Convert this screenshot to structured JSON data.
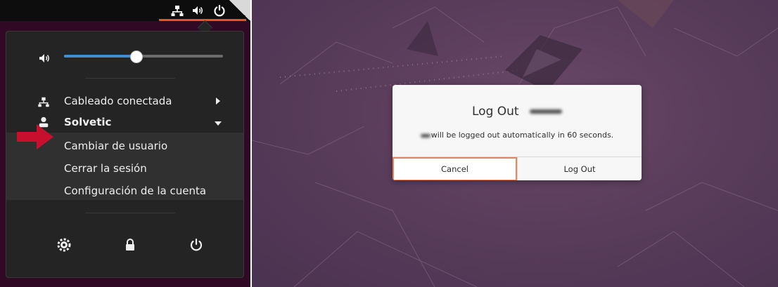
{
  "colors": {
    "accent": "#e95420",
    "menu_bg": "#242424",
    "slider_fill": "#3e8ed0",
    "annotation_arrow": "#c8102e",
    "dialog_focus_border": "#e8845f"
  },
  "left_panel": {
    "top_bar": {
      "icons": [
        "network-icon",
        "speaker-icon",
        "power-icon"
      ]
    },
    "menu": {
      "volume": {
        "icon": "speaker-icon",
        "level": 0.45
      },
      "items": [
        {
          "label": "Cableado conectada",
          "icon": "network-icon",
          "arrow": "chevron-right-icon"
        },
        {
          "label": "Solvetic",
          "icon": "user-icon",
          "arrow": "chevron-down-icon"
        }
      ],
      "submenu": [
        {
          "label": "Cambiar de usuario"
        },
        {
          "label": "Cerrar la sesión"
        },
        {
          "label": "Configuración de la cuenta"
        }
      ],
      "bottom_buttons": [
        "settings-icon",
        "lock-icon",
        "power-icon"
      ]
    }
  },
  "right_panel": {
    "dialog": {
      "title": "Log Out",
      "message": "will be logged out automatically in 60 seconds.",
      "buttons": {
        "cancel": "Cancel",
        "logout": "Log Out"
      }
    }
  }
}
